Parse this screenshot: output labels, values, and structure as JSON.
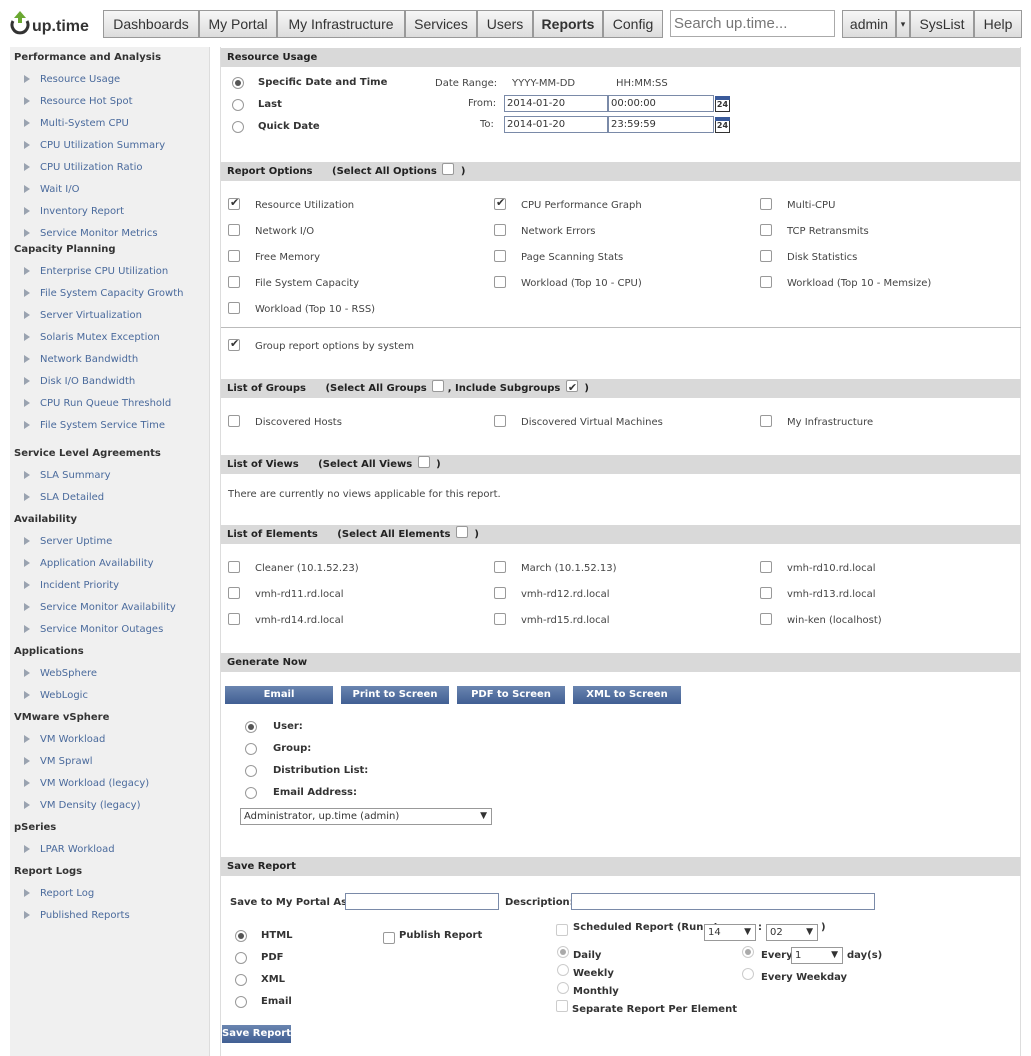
{
  "brand": {
    "name": "up.time"
  },
  "nav": {
    "dashboards": "Dashboards",
    "my_portal": "My Portal",
    "my_infrastructure": "My Infrastructure",
    "services": "Services",
    "users": "Users",
    "reports": "Reports",
    "config": "Config",
    "search_placeholder": "Search up.time...",
    "admin": "admin",
    "syslist": "SysList",
    "help": "Help"
  },
  "sidebar": {
    "performance": {
      "title": "Performance and Analysis",
      "items": [
        "Resource Usage",
        "Resource Hot Spot",
        "Multi-System CPU",
        "CPU Utilization Summary",
        "CPU Utilization Ratio",
        "Wait I/O",
        "Inventory Report",
        "Service Monitor Metrics"
      ]
    },
    "capacity": {
      "title": "Capacity Planning",
      "items": [
        "Enterprise CPU Utilization",
        "File System Capacity Growth",
        "Server Virtualization",
        "Solaris Mutex Exception",
        "Network Bandwidth",
        "Disk I/O Bandwidth",
        "CPU Run Queue Threshold",
        "File System Service Time"
      ]
    },
    "sla": {
      "title": "Service Level Agreements",
      "items": [
        "SLA Summary",
        "SLA Detailed"
      ]
    },
    "availability": {
      "title": "Availability",
      "items": [
        "Server Uptime",
        "Application Availability",
        "Incident Priority",
        "Service Monitor Availability",
        "Service Monitor Outages"
      ]
    },
    "applications": {
      "title": "Applications",
      "items": [
        "WebSphere",
        "WebLogic"
      ]
    },
    "vmware": {
      "title": "VMware vSphere",
      "items": [
        "VM Workload",
        "VM Sprawl",
        "VM Workload (legacy)",
        "VM Density (legacy)"
      ]
    },
    "pseries": {
      "title": "pSeries",
      "items": [
        "LPAR Workload"
      ]
    },
    "logs": {
      "title": "Report Logs",
      "items": [
        "Report Log",
        "Published Reports"
      ]
    }
  },
  "resource_usage": {
    "title": "Resource Usage",
    "specific": "Specific Date and Time",
    "last": "Last",
    "quick": "Quick Date",
    "date_range_label": "Date Range:",
    "date_format": "YYYY-MM-DD",
    "time_format": "HH:MM:SS",
    "from_label": "From:",
    "to_label": "To:",
    "from_date": "2014-01-20",
    "from_time": "00:00:00",
    "to_date": "2014-01-20",
    "to_time": "23:59:59",
    "calendar_label": "24"
  },
  "report_options": {
    "title": "Report Options",
    "select_all": "(Select All Options",
    "close_paren": ")",
    "options": [
      {
        "label": "Resource Utilization",
        "checked": true
      },
      {
        "label": "CPU Performance Graph",
        "checked": true
      },
      {
        "label": "Multi-CPU",
        "checked": false
      },
      {
        "label": "Network I/O",
        "checked": false
      },
      {
        "label": "Network Errors",
        "checked": false
      },
      {
        "label": "TCP Retransmits",
        "checked": false
      },
      {
        "label": "Free Memory",
        "checked": false
      },
      {
        "label": "Page Scanning Stats",
        "checked": false
      },
      {
        "label": "Disk Statistics",
        "checked": false
      },
      {
        "label": "File System Capacity",
        "checked": false
      },
      {
        "label": "Workload (Top 10 - CPU)",
        "checked": false
      },
      {
        "label": "Workload (Top 10 - Memsize)",
        "checked": false
      },
      {
        "label": "Workload (Top 10 - RSS)",
        "checked": false
      }
    ],
    "group_by_system": "Group report options by system"
  },
  "groups": {
    "title": "List of Groups",
    "select_all": "(Select All Groups",
    "include_sub": ", Include Subgroups",
    "close_paren": ")",
    "items": [
      "Discovered Hosts",
      "Discovered Virtual Machines",
      "My Infrastructure"
    ]
  },
  "views": {
    "title": "List of Views",
    "select_all": "(Select All Views",
    "close_paren": ")",
    "empty": "There are currently no views applicable for this report."
  },
  "elements": {
    "title": "List of Elements",
    "select_all": "(Select All Elements",
    "close_paren": ")",
    "items": [
      "Cleaner (10.1.52.23)",
      "March (10.1.52.13)",
      "vmh-rd10.rd.local",
      "vmh-rd11.rd.local",
      "vmh-rd12.rd.local",
      "vmh-rd13.rd.local",
      "vmh-rd14.rd.local",
      "vmh-rd15.rd.local",
      "win-ken (localhost)"
    ]
  },
  "generate": {
    "title": "Generate Now",
    "email": "Email",
    "print": "Print to Screen",
    "pdf": "PDF to Screen",
    "xml": "XML to Screen",
    "user": "User:",
    "group": "Group:",
    "distribution": "Distribution List:",
    "email_address": "Email Address:",
    "user_select": "Administrator, up.time (admin)"
  },
  "save": {
    "title": "Save Report",
    "portal_label": "Save to My Portal As:",
    "description_label": "Description:",
    "html": "HTML",
    "pdf": "PDF",
    "xml": "XML",
    "email": "Email",
    "publish": "Publish Report",
    "scheduled": "Scheduled Report (Run at",
    "hour": "14",
    "colon": ":",
    "minute": "02",
    "close_paren": ")",
    "daily": "Daily",
    "weekly": "Weekly",
    "monthly": "Monthly",
    "every": "Every",
    "every_value": "1",
    "days": "day(s)",
    "every_weekday": "Every Weekday",
    "separate": "Separate Report Per Element",
    "button": "Save Report"
  }
}
